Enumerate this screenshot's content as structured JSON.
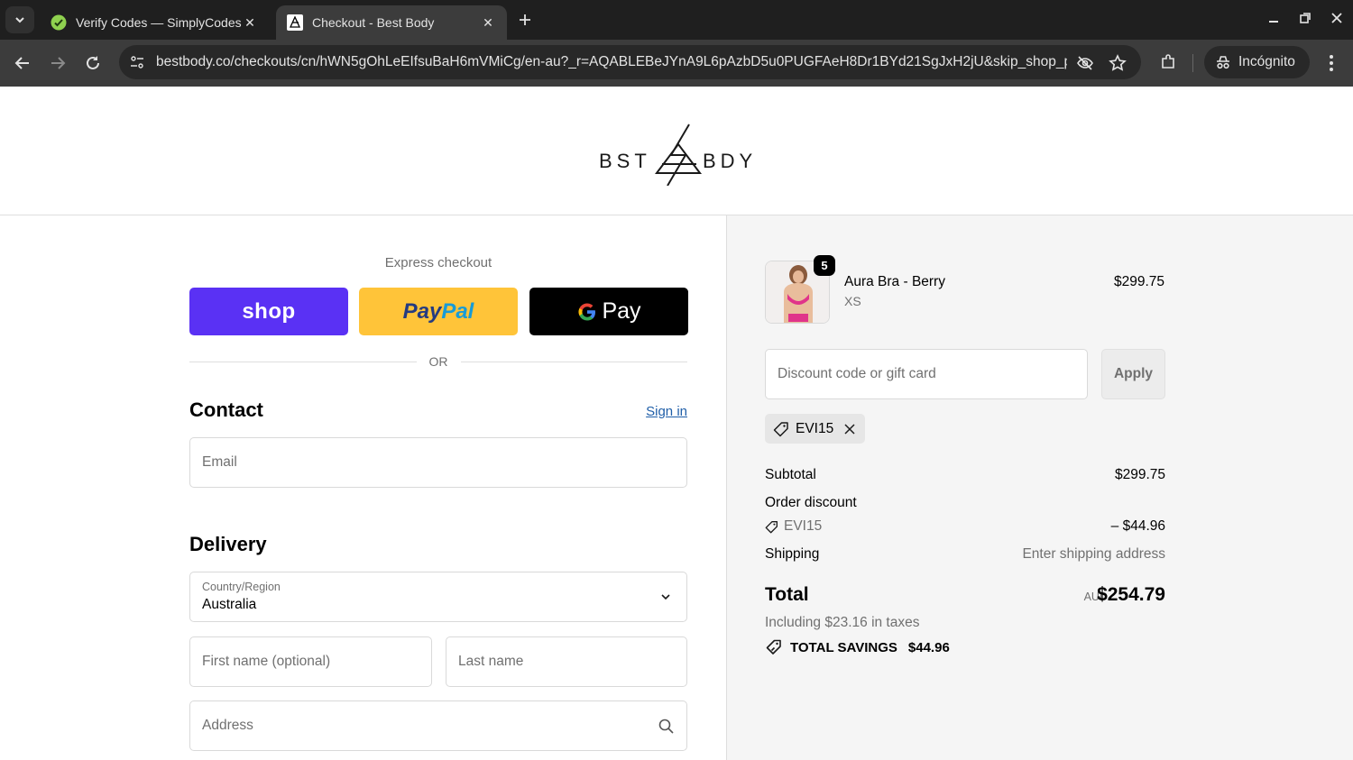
{
  "browser": {
    "tabs": [
      {
        "title": "Verify Codes — SimplyCodes",
        "icon": "simplycodes-icon",
        "active": false
      },
      {
        "title": "Checkout - Best Body",
        "icon": "bestbody-icon",
        "active": true
      }
    ],
    "url": "bestbody.co/checkouts/cn/hWN5gOhLeEIfsuBaH6mVMiCg/en-au?_r=AQABLEBeJYnA9L6pAzbD5u0PUGFAeH8Dr1BYd21SgJxH2jU&skip_shop_p...",
    "incognito_label": "Incógnito"
  },
  "header": {
    "logo_left": "BST",
    "logo_right": "BDY"
  },
  "checkout": {
    "express_label": "Express checkout",
    "shop_label": "shop",
    "paypal_label_a": "Pay",
    "paypal_label_b": "Pal",
    "gpay_label": "Pay",
    "or_label": "OR",
    "contact": {
      "heading": "Contact",
      "sign_in": "Sign in",
      "email_placeholder": "Email"
    },
    "delivery": {
      "heading": "Delivery",
      "country_label": "Country/Region",
      "country_value": "Australia",
      "first_name_placeholder": "First name (optional)",
      "last_name_placeholder": "Last name",
      "address_placeholder": "Address"
    }
  },
  "summary": {
    "item": {
      "name": "Aura Bra - Berry",
      "variant": "XS",
      "price": "$299.75",
      "quantity": "5"
    },
    "discount_placeholder": "Discount code or gift card",
    "apply_label": "Apply",
    "applied_code": "EVI15",
    "subtotal_label": "Subtotal",
    "subtotal_value": "$299.75",
    "order_discount_label": "Order discount",
    "discount_code": "EVI15",
    "discount_value": "– $44.96",
    "shipping_label": "Shipping",
    "shipping_value": "Enter shipping address",
    "total_label": "Total",
    "currency": "AUD",
    "total_value": "$254.79",
    "tax_line": "Including $23.16 in taxes",
    "savings_label": "TOTAL SAVINGS",
    "savings_value": "$44.96"
  },
  "colors": {
    "shop": "#5a31f4",
    "paypal": "#ffc439",
    "gpay": "#000000",
    "link": "#1f5ea8",
    "summary_bg": "#f5f5f5"
  }
}
